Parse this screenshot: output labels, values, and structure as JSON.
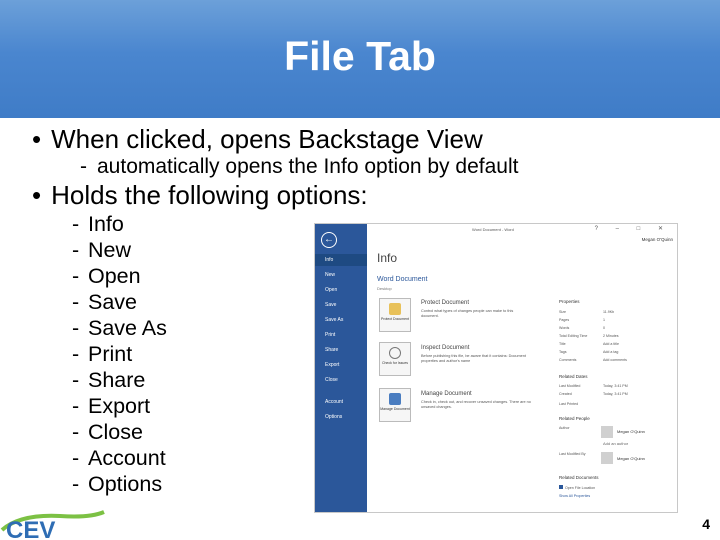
{
  "slide": {
    "title": "File Tab",
    "bullet1": "When clicked, opens Backstage View",
    "sub1": "automatically opens the Info option by default",
    "bullet2": "Holds the following options:",
    "options": [
      "Info",
      "New",
      "Open",
      "Save",
      "Save As",
      "Print",
      "Share",
      "Export",
      "Close",
      "Account",
      "Options"
    ],
    "page_number": "4",
    "logo_text": "CEV"
  },
  "screenshot": {
    "window_title": "Word Document - Word",
    "user_name": "Megan O'Quinn",
    "window_controls": "? – □ ✕",
    "back_icon": "back-arrow-icon",
    "sidebar": [
      "Info",
      "New",
      "Open",
      "Save",
      "Save As",
      "Print",
      "Share",
      "Export",
      "Close",
      "Account",
      "Options"
    ],
    "selected_sidebar": "Info",
    "heading": "Info",
    "doc_name": "Word Document",
    "doc_location": "Desktop",
    "cards": [
      {
        "button": "Protect Document",
        "title": "Protect Document",
        "text": "Control what types of changes people can make to this document."
      },
      {
        "button": "Check for Issues",
        "title": "Inspect Document",
        "text": "Before publishing this file, be aware that it contains: Document properties and author's name"
      },
      {
        "button": "Manage Document",
        "title": "Manage Document",
        "text": "Check in, check out, and recover unsaved changes. There are no unsaved changes."
      }
    ],
    "properties_label": "Properties",
    "properties": [
      [
        "Size",
        "11.9Kb"
      ],
      [
        "Pages",
        "1"
      ],
      [
        "Words",
        "0"
      ],
      [
        "Total Editing Time",
        "2 Minutes"
      ],
      [
        "Title",
        "Add a title"
      ],
      [
        "Tags",
        "Add a tag"
      ],
      [
        "Comments",
        "Add comments"
      ]
    ],
    "related_dates_label": "Related Dates",
    "dates": [
      [
        "Last Modified",
        "Today, 3:41 PM"
      ],
      [
        "Created",
        "Today, 3:41 PM"
      ],
      [
        "Last Printed",
        ""
      ]
    ],
    "related_people_label": "Related People",
    "author_label": "Author",
    "author_name": "Megan O'Quinn",
    "add_author": "Add an author",
    "last_modified_by_label": "Last Modified By",
    "last_modified_by": "Megan O'Quinn",
    "related_docs_label": "Related Documents",
    "open_file_location": "Open File Location",
    "show_all_properties": "Show All Properties",
    "colors": {
      "sidebar": "#2b579a",
      "accent": "#2b579a"
    }
  }
}
